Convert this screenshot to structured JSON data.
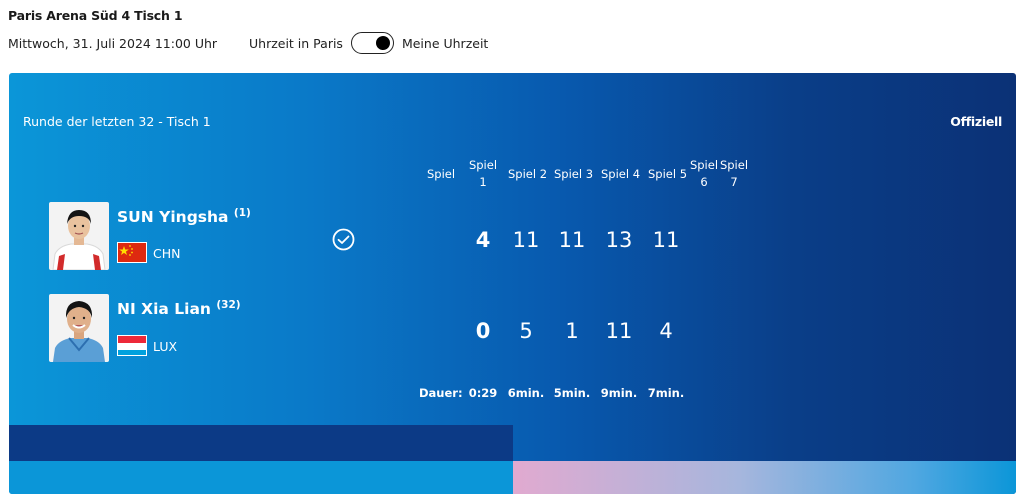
{
  "header": {
    "venue": "Paris Arena Süd 4 Tisch 1",
    "datetime": "Mittwoch, 31. Juli 2024 11:00 Uhr",
    "tz_left": "Uhrzeit in Paris",
    "tz_right": "Meine Uhrzeit"
  },
  "match": {
    "round": "Runde der letzten 32 - Tisch 1",
    "status": "Offiziell",
    "headers": {
      "spiel": "Spiel",
      "g1": "Spiel 1",
      "g2": "Spiel 2",
      "g3": "Spiel 3",
      "g4": "Spiel 4",
      "g5": "Spiel 5",
      "g6": "Spiel 6",
      "g7": "Spiel 7"
    },
    "players": [
      {
        "name": "SUN Yingsha",
        "seed": "(1)",
        "country": "CHN",
        "games_won": "4",
        "scores": [
          "11",
          "11",
          "13",
          "11"
        ]
      },
      {
        "name": "NI Xia Lian",
        "seed": "(32)",
        "country": "LUX",
        "games_won": "0",
        "scores": [
          "5",
          "1",
          "11",
          "4"
        ]
      }
    ],
    "duration": {
      "label": "Dauer:",
      "total": "0:29",
      "games": [
        "6min.",
        "5min.",
        "9min.",
        "7min."
      ]
    }
  }
}
